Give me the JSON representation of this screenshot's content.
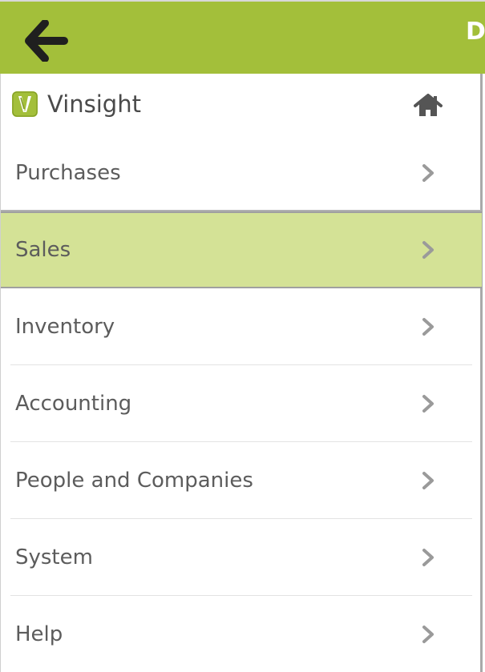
{
  "header": {
    "title_partial": "D",
    "back_icon": "arrow-left-icon",
    "colors": {
      "bar": "#a3bf3a"
    }
  },
  "brand": {
    "name": "Vinsight",
    "logo_icon": "vinsight-logo-icon",
    "home_icon": "home-icon"
  },
  "menu": {
    "items": [
      {
        "label": "Purchases",
        "icon": "chevron-right-icon",
        "active": false
      },
      {
        "label": "Sales",
        "icon": "chevron-right-icon",
        "active": true
      },
      {
        "label": "Inventory",
        "icon": "chevron-right-icon",
        "active": false
      },
      {
        "label": "Accounting",
        "icon": "chevron-right-icon",
        "active": false
      },
      {
        "label": "People and Companies",
        "icon": "chevron-right-icon",
        "active": false
      },
      {
        "label": "System",
        "icon": "chevron-right-icon",
        "active": false
      },
      {
        "label": "Help",
        "icon": "chevron-right-icon",
        "active": false
      }
    ],
    "colors": {
      "active_background": "#d4e296",
      "label": "#5c5c5c",
      "chevron": "#9a9a9a"
    }
  }
}
